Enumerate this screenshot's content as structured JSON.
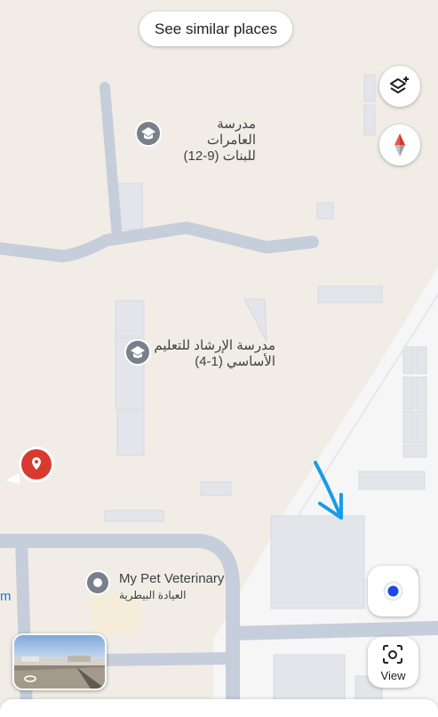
{
  "top_chip": {
    "label": "See similar places"
  },
  "controls": {
    "layers_icon": "layers-plus-icon",
    "compass_icon": "compass-icon",
    "location_icon": "my-location-icon",
    "lens_icon": "camera-lens-icon",
    "view_label": "View"
  },
  "places": [
    {
      "name_line1": "مدرسة العامرات",
      "name_line2": "للبنات (9-12)",
      "icon": "school-icon"
    },
    {
      "name_line1": "مدرسة الإرشاد للتعليم",
      "name_line2": "الأساسي (1-4)",
      "icon": "school-icon"
    },
    {
      "name_line1": "My Pet Veterinary",
      "name_line2": "العيادة البيطرية",
      "icon": "place-pin-icon"
    }
  ],
  "edge_text": "m",
  "colors": {
    "background": "#f1ede6",
    "road": "#c5cdd9",
    "building": "#e2e4ea",
    "pin_red": "#d93a2f",
    "annotation": "#1a9be6",
    "location_blue": "#1a49e6"
  }
}
